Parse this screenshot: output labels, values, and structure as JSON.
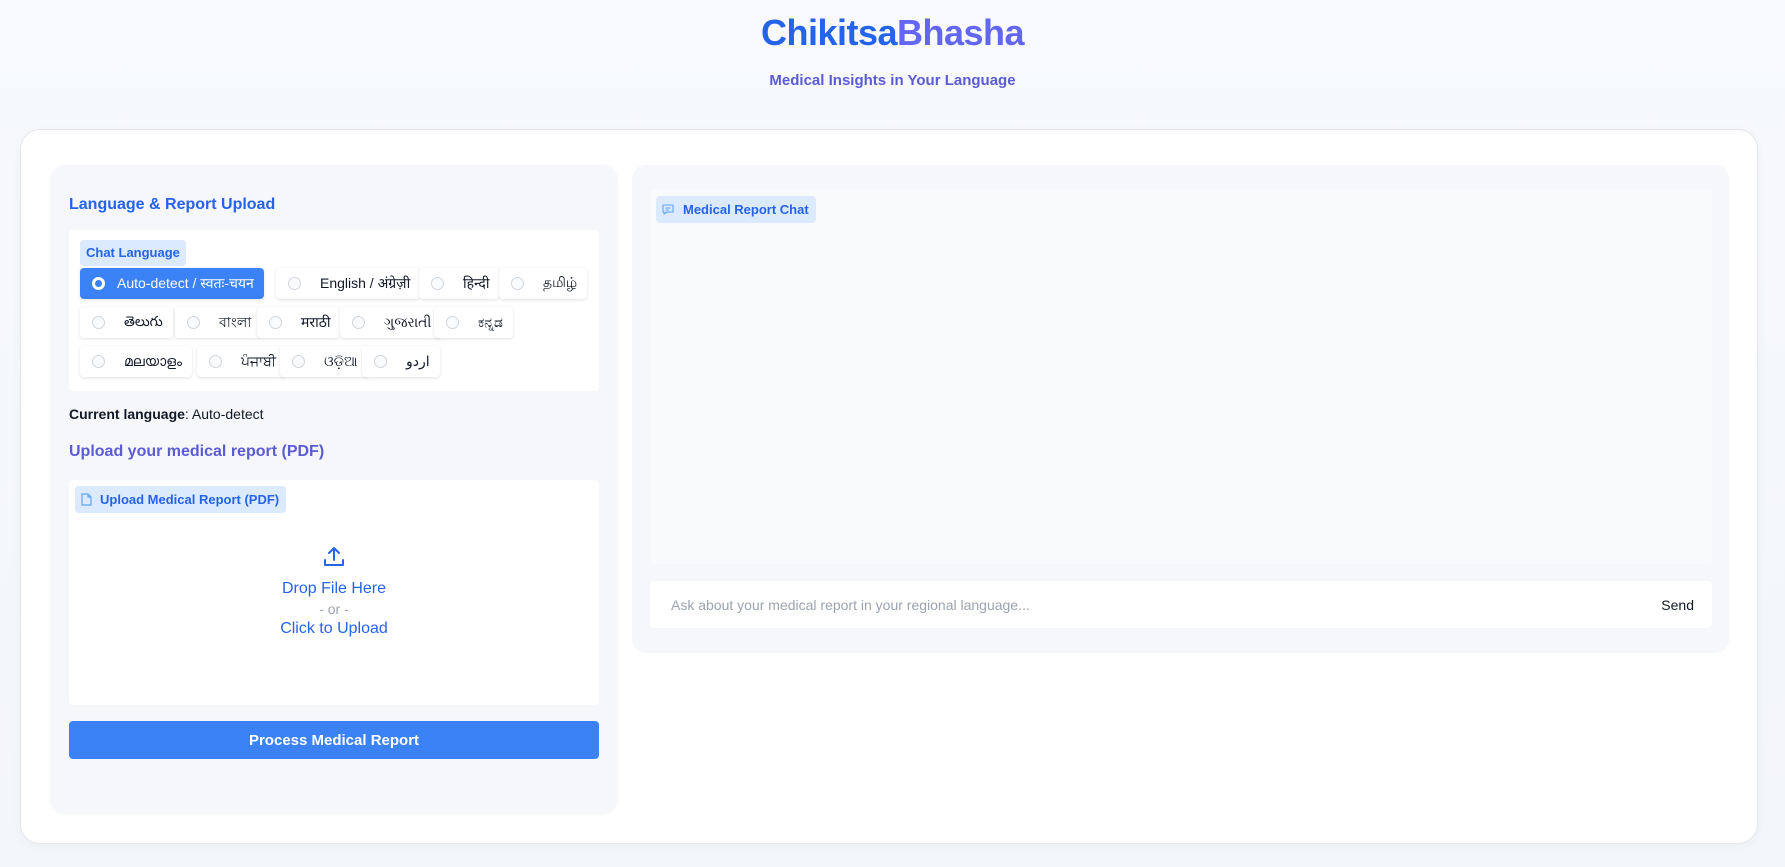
{
  "app": {
    "title_part1": "Chikitsa",
    "title_part2": "Bhasha",
    "subtitle": "Medical Insights in Your Language"
  },
  "left_panel": {
    "section_title": "Language & Report Upload",
    "language_label": "Chat Language",
    "languages": [
      {
        "label": "Auto-detect / स्वतः-चयन",
        "selected": true
      },
      {
        "label": "English / अंग्रेज़ी",
        "selected": false
      },
      {
        "label": "हिन्दी",
        "selected": false
      },
      {
        "label": "தமிழ்",
        "selected": false
      },
      {
        "label": "తెలుగు",
        "selected": false
      },
      {
        "label": "বাংলা",
        "selected": false
      },
      {
        "label": "मराठी",
        "selected": false
      },
      {
        "label": "ગુજરાતી",
        "selected": false
      },
      {
        "label": "ಕನ್ನಡ",
        "selected": false
      },
      {
        "label": "മലയാളം",
        "selected": false
      },
      {
        "label": "ਪੰਜਾਬੀ",
        "selected": false
      },
      {
        "label": "ଓଡ଼ିଆ",
        "selected": false
      },
      {
        "label": "اردو",
        "selected": false
      }
    ],
    "current_language_label": "Current language",
    "current_language_value": ": Auto-detect",
    "upload_heading": "Upload your medical report (PDF)",
    "upload_label": "Upload Medical Report (PDF)",
    "dropzone": {
      "drop_text": "Drop File Here",
      "or_text": "- or -",
      "click_text": "Click to Upload"
    },
    "process_button": "Process Medical Report"
  },
  "right_panel": {
    "chat_label": "Medical Report Chat",
    "input_placeholder": "Ask about your medical report in your regional language...",
    "send_button": "Send"
  },
  "colors": {
    "primary": "#3b82f6",
    "accent": "#2563eb",
    "indigo": "#6366f1",
    "pill_bg": "#dbeafe"
  }
}
